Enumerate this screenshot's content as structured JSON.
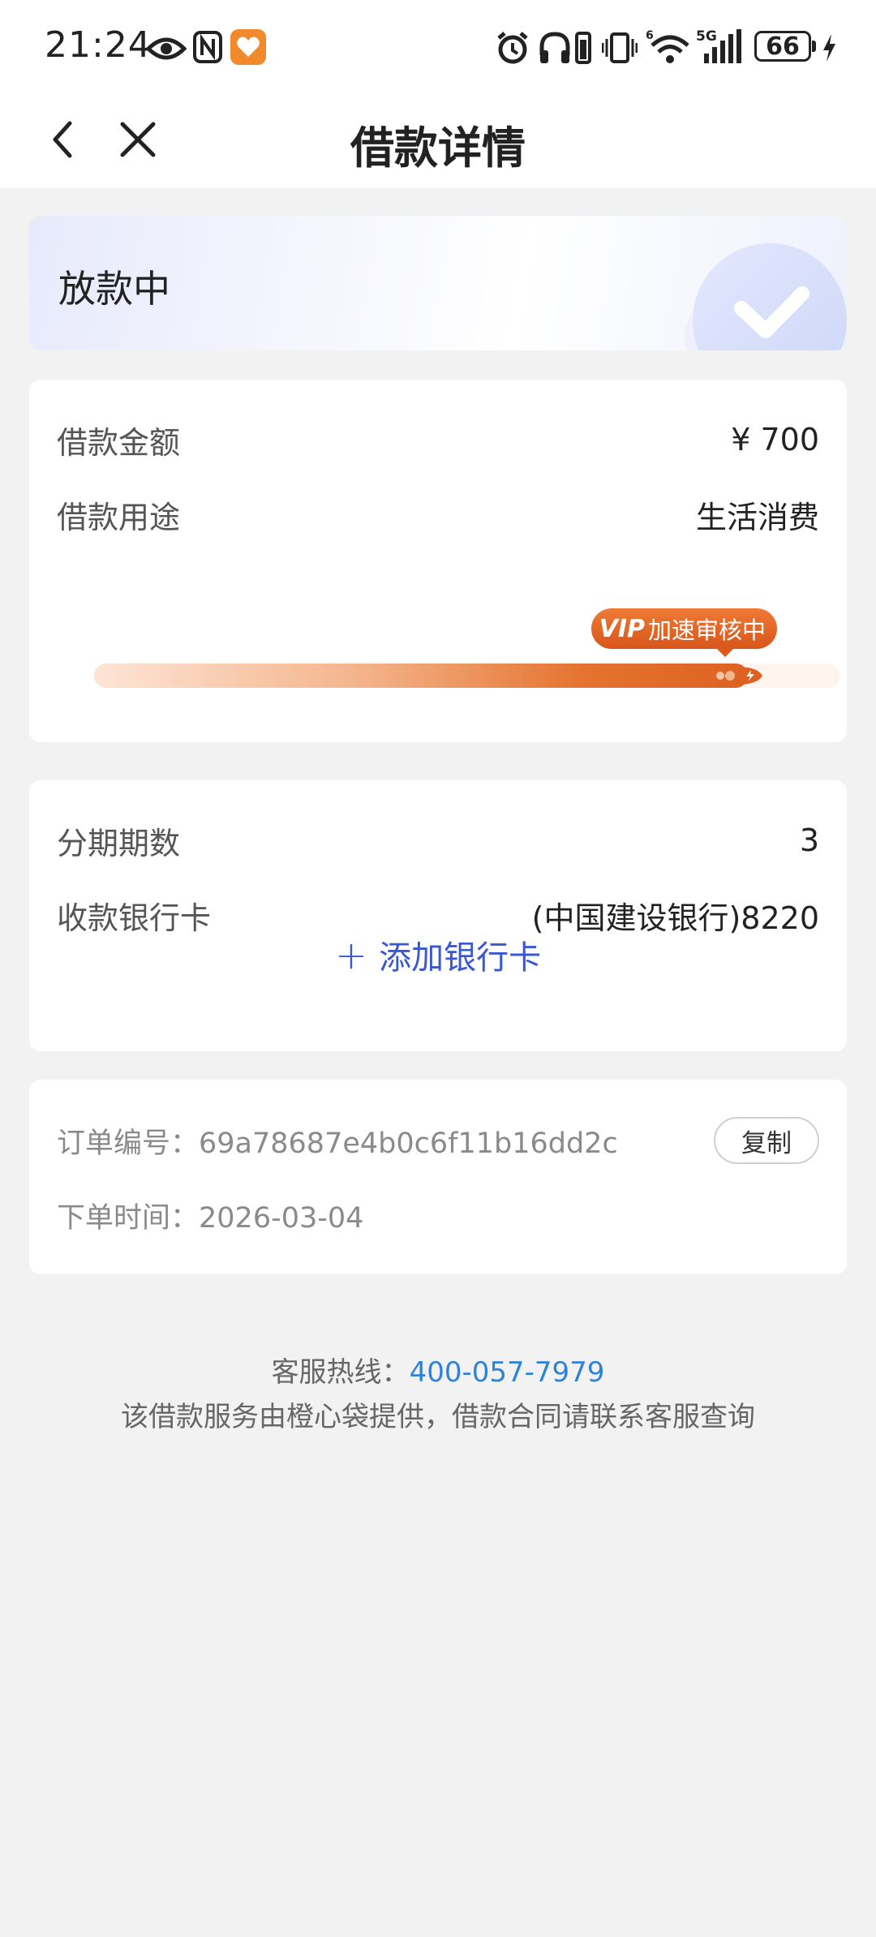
{
  "status_bar": {
    "time": "21:24",
    "battery": "66",
    "network": "5G",
    "icons": [
      "eye-icon",
      "nfc-icon",
      "app-heart-icon",
      "alarm-icon",
      "headphones-icon",
      "vibrate-icon",
      "wifi-icon",
      "signal-icon",
      "battery-icon",
      "charging-icon"
    ]
  },
  "nav": {
    "title": "借款详情",
    "back_icon": "chevron-left-icon",
    "close_icon": "close-icon"
  },
  "status_card": {
    "label": "放款中"
  },
  "loan": {
    "amount_label": "借款金额",
    "amount_value": "¥ 700",
    "purpose_label": "借款用途",
    "purpose_value": "生活消费",
    "vip_mark": "VIP",
    "vip_text": "加速审核中",
    "progress": 0.92
  },
  "installment": {
    "periods_label": "分期期数",
    "periods_value": "3",
    "bank_label": "收款银行卡",
    "bank_value": "(中国建设银行)8220",
    "add_card_plus": "+",
    "add_card_label": "添加银行卡"
  },
  "order": {
    "number_label": "订单编号：",
    "number_value": "69a78687e4b0c6f11b16dd2c",
    "copy_label": "复制",
    "time_label": "下单时间：",
    "time_value": "2026-03-04"
  },
  "footer": {
    "hotline_label": "客服热线：",
    "hotline_number": "400-057-7979",
    "note": "该借款服务由橙心袋提供，借款合同请联系客服查询"
  },
  "colors": {
    "accent_orange": "#dd6222",
    "link_blue": "#3a57d6",
    "phone_blue": "#2f82d8",
    "background": "#f2f2f2"
  }
}
